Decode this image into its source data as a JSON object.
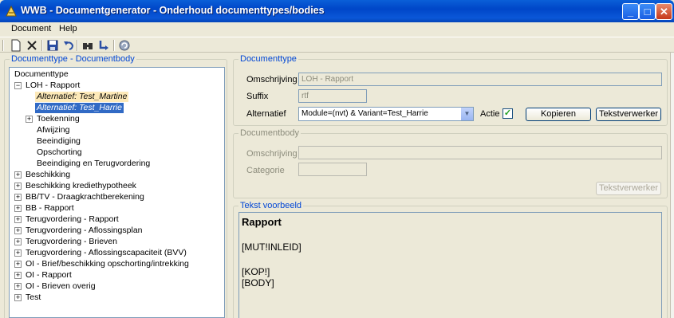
{
  "window": {
    "title": "WWB - Documentgenerator - Onderhoud documenttypes/bodies"
  },
  "menu": [
    "Document",
    "Help"
  ],
  "toolbar_icons": [
    "new-document-icon",
    "delete-icon",
    "save-icon",
    "undo-icon",
    "find-icon",
    "goto-icon",
    "refresh-icon"
  ],
  "tree_panel": {
    "title": "Documenttype - Documentbody",
    "items": [
      {
        "label": "Documenttype"
      },
      {
        "label": "LOH - Rapport",
        "toggle": "⊟"
      },
      {
        "label": "Alternatief: Test_Martine"
      },
      {
        "label": "Alternatief: Test_Harrie"
      },
      {
        "label": "Toekenning",
        "toggle": "⊞"
      },
      {
        "label": "Afwijzing"
      },
      {
        "label": "Beeindiging"
      },
      {
        "label": "Opschorting"
      },
      {
        "label": "Beeindiging en Terugvordering"
      },
      {
        "label": "Beschikking",
        "toggle": "⊞"
      },
      {
        "label": "Beschikking krediethypotheek",
        "toggle": "⊞"
      },
      {
        "label": "BB/TV - Draagkrachtberekening",
        "toggle": "⊞"
      },
      {
        "label": "BB - Rapport",
        "toggle": "⊞"
      },
      {
        "label": "Terugvordering - Rapport",
        "toggle": "⊞"
      },
      {
        "label": "Terugvordering - Aflossingsplan",
        "toggle": "⊞"
      },
      {
        "label": "Terugvordering - Brieven",
        "toggle": "⊞"
      },
      {
        "label": "Terugvordering - Aflossingscapaciteit (BVV)",
        "toggle": "⊞"
      },
      {
        "label": "OI - Brief/beschikking opschorting/intrekking",
        "toggle": "⊞"
      },
      {
        "label": "OI - Rapport",
        "toggle": "⊞"
      },
      {
        "label": "OI - Brieven overig",
        "toggle": "⊞"
      },
      {
        "label": "Test",
        "toggle": "⊞"
      }
    ]
  },
  "documenttype": {
    "title": "Documenttype",
    "omschrijving_label": "Omschrijving",
    "omschrijving_value": "LOH - Rapport",
    "suffix_label": "Suffix",
    "suffix_value": "rtf",
    "alternatief_label": "Alternatief",
    "alternatief_value": "Module=(nvt) & Variant=Test_Harrie",
    "actie_label": "Actie",
    "actie_checked": true,
    "kopieren_label": "Kopieren",
    "tekstverwerker_label": "Tekstverwerker"
  },
  "documentbody": {
    "title": "Documentbody",
    "omschrijving_label": "Omschrijving",
    "omschrijving_value": "",
    "categorie_label": "Categorie",
    "categorie_value": "",
    "tekstverwerker_label": "Tekstverwerker"
  },
  "preview": {
    "title": "Tekst voorbeeld",
    "heading": "Rapport",
    "lines": [
      "[MUT!INLEID]",
      "[KOP!]",
      "[BODY]"
    ]
  },
  "colors": {
    "titlebar": "#0046c8",
    "selection": "#316ac5",
    "group_title": "#0046d5"
  }
}
